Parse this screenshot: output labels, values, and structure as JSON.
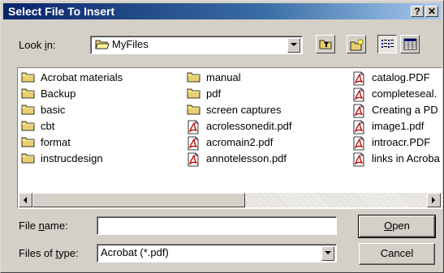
{
  "dialog": {
    "title": "Select File To Insert",
    "help_button": "?",
    "close_button": "✕"
  },
  "look_in": {
    "label_prefix": "Look ",
    "label_accel": "i",
    "label_suffix": "n:",
    "value": "MyFiles"
  },
  "toolbar": {
    "up_folder": "up-one-level-icon",
    "new_folder": "new-folder-icon",
    "list_view": "list-view-icon",
    "details_view": "details-view-icon"
  },
  "files": {
    "columns": [
      [
        {
          "icon": "folder-icon",
          "name": "Acrobat materials"
        },
        {
          "icon": "folder-icon",
          "name": "Backup"
        },
        {
          "icon": "folder-icon",
          "name": "basic"
        },
        {
          "icon": "folder-icon",
          "name": "cbt"
        },
        {
          "icon": "folder-icon",
          "name": "format"
        },
        {
          "icon": "folder-icon",
          "name": "instrucdesign"
        }
      ],
      [
        {
          "icon": "folder-icon",
          "name": "manual"
        },
        {
          "icon": "folder-icon",
          "name": "pdf"
        },
        {
          "icon": "folder-icon",
          "name": "screen captures"
        },
        {
          "icon": "pdf-file-icon",
          "name": "acrolessonedit.pdf"
        },
        {
          "icon": "pdf-file-icon",
          "name": "acromain2.pdf"
        },
        {
          "icon": "pdf-file-icon",
          "name": "annotelesson.pdf"
        }
      ],
      [
        {
          "icon": "pdf-file-icon",
          "name": "catalog.PDF"
        },
        {
          "icon": "pdf-file-icon",
          "name": "completeseal."
        },
        {
          "icon": "pdf-file-icon",
          "name": "Creating a PD"
        },
        {
          "icon": "pdf-file-icon",
          "name": "image1.pdf"
        },
        {
          "icon": "pdf-file-icon",
          "name": "introacr.PDF"
        },
        {
          "icon": "pdf-file-icon",
          "name": "links in Acroba"
        }
      ]
    ]
  },
  "file_name": {
    "label_prefix": "File ",
    "label_accel": "n",
    "label_suffix": "ame:",
    "value": ""
  },
  "file_type": {
    "label_prefix": "Files of ",
    "label_accel": "t",
    "label_suffix": "ype:",
    "value": "Acrobat (*.pdf)"
  },
  "buttons": {
    "open_accel": "O",
    "open_rest": "pen",
    "cancel": "Cancel"
  }
}
